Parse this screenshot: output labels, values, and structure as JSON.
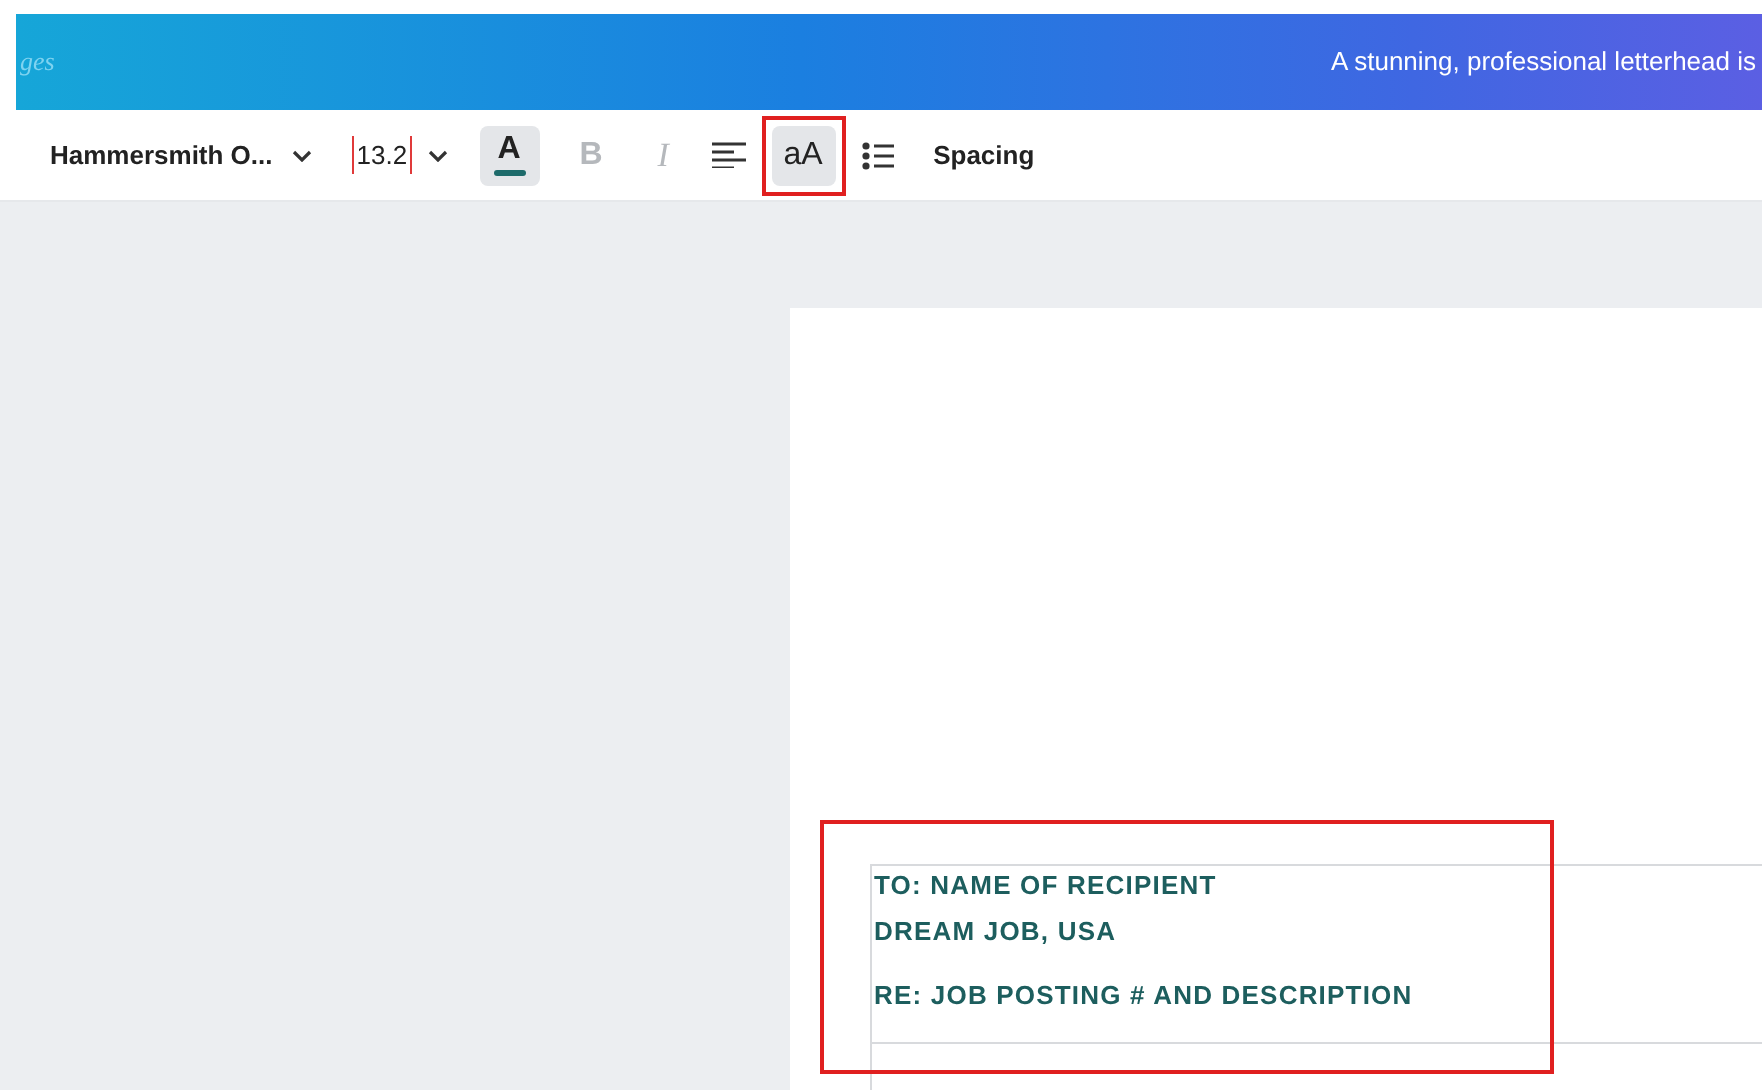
{
  "banner": {
    "cut_text": "ges",
    "tagline": "A stunning, professional letterhead is"
  },
  "toolbar": {
    "font": "Hammersmith O...",
    "size": "13.2",
    "text_color": {
      "label": "A",
      "color": "#1e6b6b",
      "selected": true
    },
    "bold": {
      "label": "B",
      "disabled": true
    },
    "italic": {
      "label": "I",
      "disabled": true
    },
    "case": {
      "label": "aA",
      "selected": true,
      "highlighted": true
    },
    "spacing": "Spacing"
  },
  "document": {
    "highlighted": true,
    "paragraphs": [
      [
        "TO: NAME OF RECIPIENT",
        "DREAM JOB, USA"
      ],
      [
        "RE: JOB POSTING # AND DESCRIPTION"
      ]
    ]
  }
}
